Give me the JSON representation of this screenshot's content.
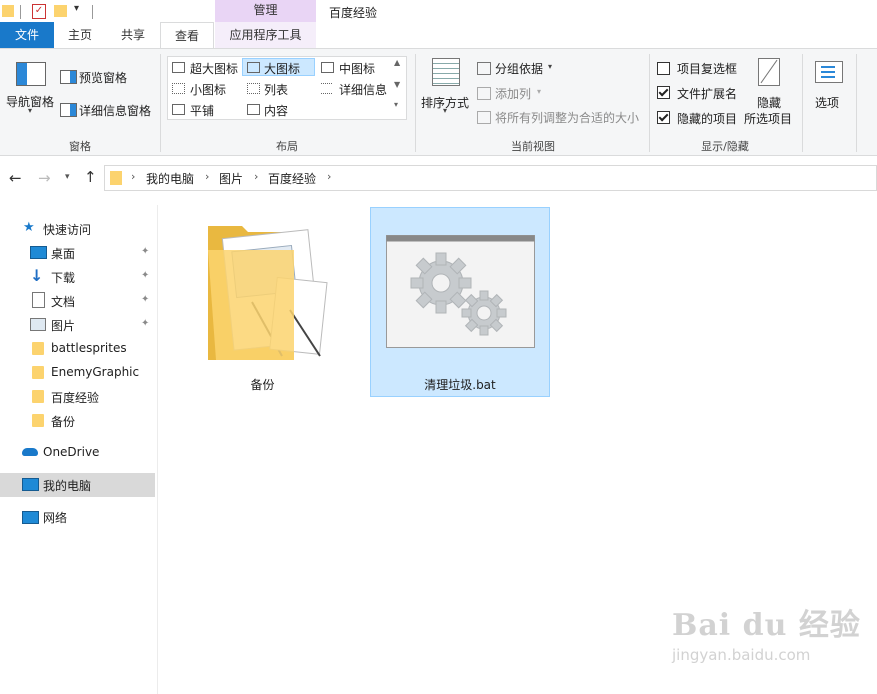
{
  "titlebar": {
    "manage_label": "管理",
    "window_title": "百度经验"
  },
  "tabs": {
    "file": "文件",
    "home": "主页",
    "share": "共享",
    "view": "查看",
    "app_tools": "应用程序工具"
  },
  "ribbon": {
    "pane": {
      "nav_pane": "导航窗格",
      "preview_pane": "预览窗格",
      "details_pane": "详细信息窗格",
      "group_label": "窗格"
    },
    "layout": {
      "extra_large": "超大图标",
      "large": "大图标",
      "medium": "中图标",
      "small": "小图标",
      "list": "列表",
      "details": "详细信息",
      "tiles": "平铺",
      "content": "内容",
      "group_label": "布局",
      "selected": "大图标"
    },
    "current_view": {
      "sort_by": "排序方式",
      "group_by": "分组依据",
      "add_column": "添加列",
      "size_all_columns": "将所有列调整为合适的大小",
      "group_label": "当前视图"
    },
    "show_hide": {
      "item_checkboxes": "项目复选框",
      "file_extensions": "文件扩展名",
      "hidden_items": "隐藏的项目",
      "hide_selected_line1": "隐藏",
      "hide_selected_line2": "所选项目",
      "group_label": "显示/隐藏",
      "item_checkboxes_checked": false,
      "file_extensions_checked": true,
      "hidden_items_checked": true
    },
    "options": "选项"
  },
  "address": {
    "crumbs": [
      "我的电脑",
      "图片",
      "百度经验"
    ]
  },
  "nav": {
    "quick_access": "快速访问",
    "items": [
      "桌面",
      "下载",
      "文档",
      "图片",
      "battlesprites",
      "EnemyGraphic",
      "百度经验",
      "备份"
    ],
    "onedrive": "OneDrive",
    "this_pc": "我的电脑",
    "network": "网络"
  },
  "files": [
    {
      "name": "备份",
      "type": "folder"
    },
    {
      "name": "清理垃圾.bat",
      "type": "batch-file",
      "selected": true
    }
  ],
  "watermark": {
    "brand": "Bai du 经验",
    "url": "jingyan.baidu.com"
  },
  "colors": {
    "accent": "#1979ca",
    "manage_tab": "#e9d5f5",
    "selection": "#cce8ff",
    "folder": "#fcd36e"
  }
}
